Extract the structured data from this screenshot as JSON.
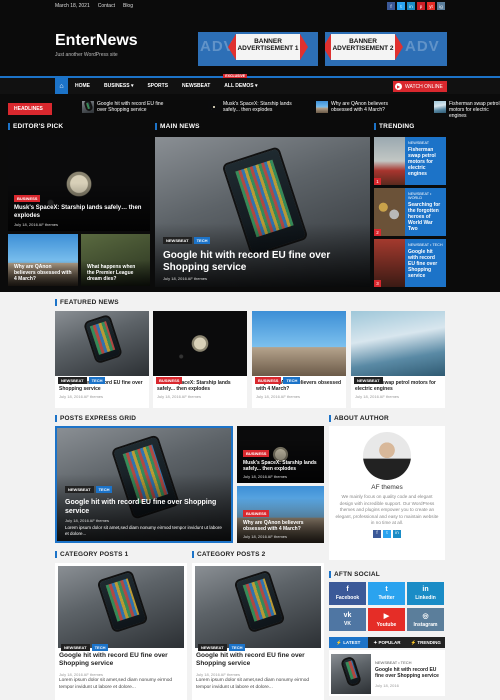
{
  "topbar": {
    "date": "March 18, 2021",
    "links": [
      "Contact",
      "Blog"
    ],
    "social_icons": [
      "f",
      "t",
      "in",
      "p",
      "yt",
      "ig"
    ]
  },
  "header": {
    "logo": "EnterNews",
    "tagline": "Just another WordPress site",
    "banners": [
      {
        "label": "BANNER ADVERTISEMENT 1",
        "bg": "ADVE"
      },
      {
        "label": "BANNER ADVERTISEMENT 2",
        "bg": "ADV"
      }
    ]
  },
  "nav": {
    "home_icon": "home-icon",
    "items": [
      "HOME",
      "BUSINESS ▾",
      "SPORTS",
      "NEWSBEAT",
      "ALL DEMOS ▾"
    ],
    "exclusive": "EXCLUSIVE",
    "watch": "WATCH ONLINE"
  },
  "ticker": {
    "label": "HEADLINES",
    "items": [
      "Google hit with record EU fine over Shopping service",
      "Musk's SpaceX: Starship lands safely... then explodes",
      "Why are QAnon believers obsessed with 4 March?",
      "Fisherman swap petrol motors for electric engines"
    ]
  },
  "editors_pick": {
    "title": "EDITOR'S PICK",
    "main": {
      "badge": "BUSINESS",
      "title": "Musk's SpaceX: Starship lands safely… then explodes",
      "meta": "July 18, 2016  AF themes"
    },
    "small": [
      {
        "title": "Why are QAnon believers obsessed with 4 March?"
      },
      {
        "title": "What happens when the Premier League dream dies?"
      }
    ]
  },
  "main_news": {
    "title": "MAIN NEWS",
    "badges": [
      "NEWSBEAT",
      "TECH"
    ],
    "headline": "Google hit with record EU fine over Shopping service",
    "meta": "July 18, 2016  AF themes"
  },
  "trending": {
    "title": "TRENDING",
    "items": [
      {
        "num": "1",
        "cat": "NEWSBEAT",
        "title": "Fisherman swap petrol motors for electric engines"
      },
      {
        "num": "2",
        "cat": "NEWSBEAT • WORLD",
        "title": "Searching for the forgotten heroes of World War Two"
      },
      {
        "num": "3",
        "cat": "NEWSBEAT • TECH",
        "title": "Google hit with record EU fine over Shopping service"
      }
    ]
  },
  "featured": {
    "title": "FEATURED NEWS",
    "items": [
      {
        "badges": [
          "NEWSBEAT",
          "TECH"
        ],
        "title": "Google hit with record EU fine over Shopping service",
        "meta": "July 18, 2016  AF themes"
      },
      {
        "badges": [
          "BUSINESS"
        ],
        "title": "Musk's SpaceX: Starship lands safely... then explodes",
        "meta": "July 18, 2016  AF themes"
      },
      {
        "badges": [
          "BUSINESS",
          "TECH"
        ],
        "title": "Why are QAnon believers obsessed with 4 March?",
        "meta": "July 18, 2016  AF themes"
      },
      {
        "badges": [
          "NEWSBEAT"
        ],
        "title": "Fisherman swap petrol motors for electric engines",
        "meta": "July 18, 2016  AF themes"
      }
    ]
  },
  "express": {
    "title": "POSTS EXPRESS GRID",
    "main": {
      "badges": [
        "NEWSBEAT",
        "TECH"
      ],
      "title": "Google hit with record EU fine over Shopping service",
      "meta": "July 18, 2016  AF themes",
      "excerpt": "Lorem ipsum dolor sit amet,sed diam nonumy eirmod tempor invidunt ut labore et dolore..."
    },
    "side": [
      {
        "badge": "BUSINESS",
        "title": "Musk's SpaceX: Starship lands safely... then explodes",
        "meta": "July 18, 2016  AF themes"
      },
      {
        "badge": "BUSINESS",
        "title": "Why are QAnon believers obsessed with 4 March?",
        "meta": "July 18, 2016  AF themes"
      }
    ]
  },
  "author": {
    "title": "ABOUT AUTHOR",
    "name": "AF themes",
    "bio": "We mainly focus on quality code and elegant design with incredible support. Our WordPress themes and plugins empower you to create an elegant, professional and easy to maintain website in no time at all."
  },
  "cat1": {
    "title": "CATEGORY POSTS 1",
    "badges": [
      "NEWSBEAT",
      "TECH"
    ],
    "post_title": "Google hit with record EU fine over Shopping service",
    "meta": "July 18, 2016  AF themes",
    "excerpt": "Lorem ipsum dolor sit amet,sed diam nonumy eirmod tempor invidunt ut labore et dolore..."
  },
  "cat2": {
    "title": "CATEGORY POSTS 2",
    "badges": [
      "NEWSBEAT",
      "TECH"
    ],
    "post_title": "Google hit with record EU fine over Shopping service",
    "meta": "July 18, 2016  AF themes",
    "excerpt": "Lorem ipsum dolor sit amet,sed diam nonumy eirmod tempor invidunt ut labore et dolore..."
  },
  "social": {
    "title": "AFTN SOCIAL",
    "items": [
      {
        "icon": "f",
        "label": "Facebook",
        "color": "#3b5998"
      },
      {
        "icon": "t",
        "label": "Twitter",
        "color": "#2aa3ef"
      },
      {
        "icon": "in",
        "label": "Linkedin",
        "color": "#1a8cc6"
      },
      {
        "icon": "vk",
        "label": "VK",
        "color": "#4f76a3"
      },
      {
        "icon": "▶",
        "label": "Youtube",
        "color": "#e52d27"
      },
      {
        "icon": "◎",
        "label": "Instagram",
        "color": "#5b7e9b"
      }
    ]
  },
  "tabs": {
    "items": [
      "LATEST",
      "POPULAR",
      "TRENDING"
    ],
    "post": {
      "cats": "NEWSBEAT • TECH",
      "title": "Google hit with record EU fine over Shopping service",
      "meta": "July 18, 2016"
    }
  },
  "colors": {
    "accent": "#1c73c8",
    "red": "#d9282e",
    "dark": "#0b0b0b"
  }
}
